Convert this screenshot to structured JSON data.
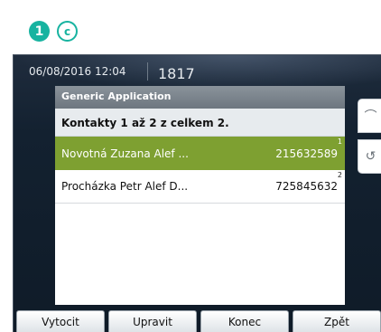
{
  "callouts": [
    "1",
    "c"
  ],
  "status_bar": {
    "datetime": "06/08/2016 12:04",
    "extension": "1817"
  },
  "app": {
    "title": "Generic Application",
    "subtitle": "Kontakty 1 až 2 z celkem 2.",
    "rows": [
      {
        "name": "Novotná Zuzana Alef ...",
        "number": "215632589",
        "index": "1",
        "selected": true
      },
      {
        "name": "Procházka Petr Alef D...",
        "number": "725845632",
        "index": "2",
        "selected": false
      }
    ]
  },
  "side_buttons": [
    {
      "icon": "phone-handset-icon",
      "glyph": "⌒"
    },
    {
      "icon": "redial-icon",
      "glyph": "↺"
    }
  ],
  "softkeys": [
    "Vytocit",
    "Upravit",
    "Konec",
    "Zpět"
  ],
  "colors": {
    "callout_accent": "#17b3a0",
    "selected_row": "#7ea031",
    "header": "#7a838c",
    "background": "#132130"
  }
}
